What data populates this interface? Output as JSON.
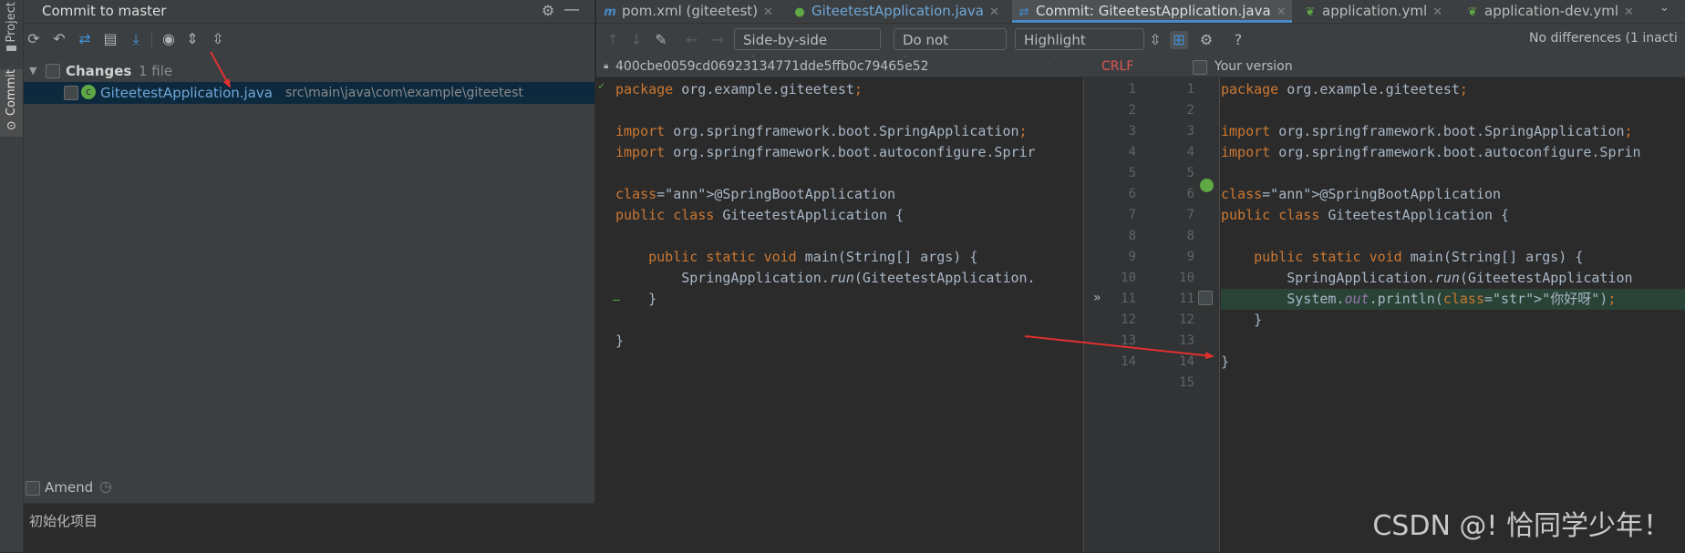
{
  "stripe": {
    "project_label": "Project",
    "commit_label": "Commit"
  },
  "commit_panel": {
    "title": "Commit to master",
    "changes_label": "Changes",
    "changes_count": "1 file",
    "file_name": "GiteetestApplication.java",
    "file_path": "src\\main\\java\\com\\example\\giteetest",
    "amend_label": "Amend",
    "commit_message": "初始化项目"
  },
  "tabs": [
    {
      "label": "pom.xml (giteetest)",
      "icon": "maven-icon",
      "active": false
    },
    {
      "label": "GiteetestApplication.java",
      "icon": "spring-class-icon",
      "active": false
    },
    {
      "label": "Commit: GiteetestApplication.java",
      "icon": "diff-icon",
      "active": true
    },
    {
      "label": "application.yml",
      "icon": "yml-icon",
      "active": false
    },
    {
      "label": "application-dev.yml",
      "icon": "yml-icon",
      "active": false
    }
  ],
  "diff_toolbar": {
    "viewer": "Side-by-side viewer",
    "ignore": "Do not ignore",
    "highlight": "Highlight words",
    "status": "No differences (1 inacti"
  },
  "diff_info": {
    "revision": "400cbe0059cd06923134771dde5ffb0c79465e52",
    "line_sep": "CRLF",
    "your_version": "Your version"
  },
  "left_code": [
    "package org.example.giteetest;",
    "",
    "import org.springframework.boot.SpringApplication;",
    "import org.springframework.boot.autoconfigure.Sprir",
    "",
    "@SpringBootApplication",
    "public class GiteetestApplication {",
    "",
    "    public static void main(String[] args) {",
    "        SpringApplication.run(GiteetestApplication.",
    "    }",
    "",
    "}",
    ""
  ],
  "right_code": [
    "package org.example.giteetest;",
    "",
    "import org.springframework.boot.SpringApplication;",
    "import org.springframework.boot.autoconfigure.Sprin",
    "",
    "@SpringBootApplication",
    "public class GiteetestApplication {",
    "",
    "    public static void main(String[] args) {",
    "        SpringApplication.run(GiteetestApplication",
    "        System.out.println(\"你好呀\");",
    "    }",
    "",
    "}",
    ""
  ],
  "left_line_numbers": [
    "1",
    "2",
    "3",
    "4",
    "5",
    "6",
    "7",
    "8",
    "9",
    "10",
    "11",
    "12",
    "13",
    "14"
  ],
  "right_line_numbers": [
    "1",
    "2",
    "3",
    "4",
    "5",
    "6",
    "7",
    "8",
    "9",
    "10",
    "11",
    "12",
    "13",
    "14",
    "15"
  ],
  "watermark": "CSDN @! 恰同学少年！",
  "colors": {
    "accent": "#4a88c7",
    "added": "#294436",
    "selection": "#0d293e"
  }
}
